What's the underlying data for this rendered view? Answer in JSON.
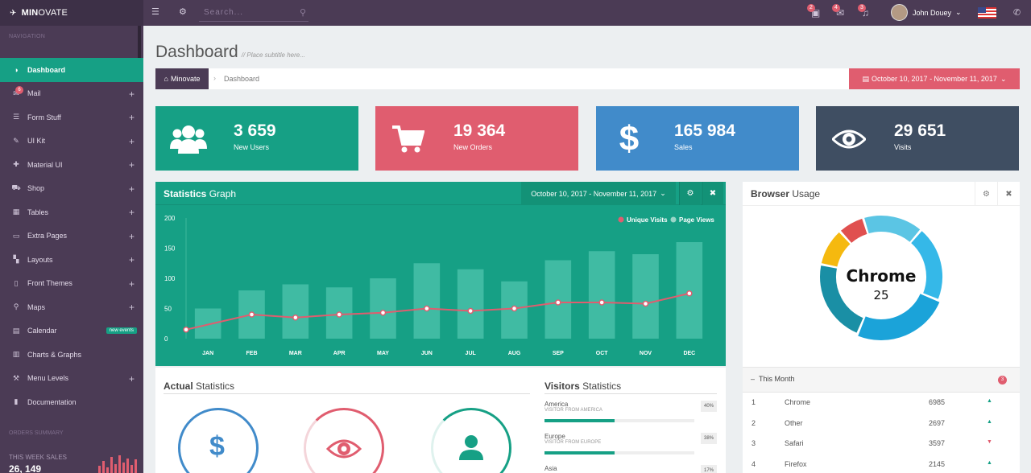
{
  "topbar": {
    "brand_bold": "MIN",
    "brand_rest": "OVATE",
    "search_placeholder": "Search...",
    "notifications": [
      "2",
      "4",
      "3"
    ],
    "user_name": "John Douey"
  },
  "sidebar": {
    "nav_title": "NAVIGATION",
    "items": [
      {
        "label": "Dashboard",
        "icon": "dashboard-icon",
        "glyph": "◑",
        "active": true
      },
      {
        "label": "Mail",
        "icon": "mail-icon",
        "glyph": "✉",
        "badge": "6",
        "plus": true
      },
      {
        "label": "Form Stuff",
        "icon": "list-icon",
        "glyph": "☰",
        "plus": true
      },
      {
        "label": "UI Kit",
        "icon": "pencil-icon",
        "glyph": "✎",
        "plus": true
      },
      {
        "label": "Material UI",
        "icon": "puzzle-icon",
        "glyph": "✚",
        "plus": true
      },
      {
        "label": "Shop",
        "icon": "cart-icon",
        "glyph": "⛟",
        "plus": true
      },
      {
        "label": "Tables",
        "icon": "table-icon",
        "glyph": "▦",
        "plus": true
      },
      {
        "label": "Extra Pages",
        "icon": "desktop-icon",
        "glyph": "▭",
        "plus": true
      },
      {
        "label": "Layouts",
        "icon": "layout-icon",
        "glyph": "▚",
        "plus": true
      },
      {
        "label": "Front Themes",
        "icon": "file-icon",
        "glyph": "▯",
        "plus": true
      },
      {
        "label": "Maps",
        "icon": "marker-icon",
        "glyph": "⚲",
        "plus": true
      },
      {
        "label": "Calendar",
        "icon": "calendar-icon",
        "glyph": "▤",
        "pill": "new events"
      },
      {
        "label": "Charts & Graphs",
        "icon": "chart-icon",
        "glyph": "▥"
      },
      {
        "label": "Menu Levels",
        "icon": "magic-icon",
        "glyph": "⚒",
        "plus": true
      },
      {
        "label": "Documentation",
        "icon": "book-icon",
        "glyph": "▮"
      }
    ],
    "orders_title": "ORDERS SUMMARY",
    "this_week_label": "THIS WEEK SALES",
    "this_week_value": "26, 149",
    "mini_bars": [
      0.4,
      0.7,
      0.3,
      0.9,
      0.5,
      1.0,
      0.6,
      0.8,
      0.45,
      0.75
    ]
  },
  "page": {
    "title": "Dashboard",
    "subtitle": "// Place subtitle here...",
    "breadcrumb_home": "Minovate",
    "breadcrumb_current": "Dashboard",
    "date_range": "October 10, 2017 - November 11, 2017"
  },
  "tiles": [
    {
      "value": "3 659",
      "label": "New Users",
      "color": "#16a085",
      "icon": "users-icon"
    },
    {
      "value": "19 364",
      "label": "New Orders",
      "color": "#e05d6f",
      "icon": "cart-icon"
    },
    {
      "value": "165 984",
      "label": "Sales",
      "color": "#418bca",
      "icon": "dollar-icon"
    },
    {
      "value": "29 651",
      "label": "Visits",
      "color": "#3f4e62",
      "icon": "eye-icon"
    }
  ],
  "statistics": {
    "title_bold": "Statistics",
    "title_rest": " Graph",
    "date_range": "October 10, 2017 - November 11, 2017"
  },
  "chart_data": {
    "type": "bar",
    "categories": [
      "JAN",
      "FEB",
      "MAR",
      "APR",
      "MAY",
      "JUN",
      "JUL",
      "AUG",
      "SEP",
      "OCT",
      "NOV",
      "DEC"
    ],
    "series": [
      {
        "name": "Page Views",
        "type": "bar",
        "values": [
          50,
          80,
          90,
          85,
          100,
          125,
          115,
          95,
          130,
          145,
          140,
          160
        ]
      },
      {
        "name": "Unique Visits",
        "type": "line",
        "values": [
          15,
          40,
          35,
          40,
          43,
          50,
          46,
          50,
          60,
          60,
          58,
          75
        ]
      }
    ],
    "yticks": [
      "0",
      "50",
      "100",
      "150",
      "200"
    ],
    "ylim": [
      0,
      200
    ],
    "legend": "top-right",
    "colors": {
      "bars": "#48c0a8",
      "line": "#e05d6f"
    }
  },
  "actual": {
    "title_bold": "Actual",
    "title_rest": " Statistics"
  },
  "visitors": {
    "title_bold": "Visitors",
    "title_rest": " Statistics",
    "rows": [
      {
        "name": "America",
        "sub": "VISITOR FROM AMERICA",
        "pct": "40%",
        "value": 0.47
      },
      {
        "name": "Europe",
        "sub": "VISITOR FROM EUROPE",
        "pct": "38%",
        "value": 0.47
      },
      {
        "name": "Asia",
        "sub": "",
        "pct": "17%",
        "value": 0.2
      }
    ]
  },
  "browser": {
    "title_bold": "Browser",
    "title_rest": " Usage",
    "center_name": "Chrome",
    "center_value": "25",
    "month_label": "This Month",
    "month_badge": "3",
    "rows": [
      {
        "rank": "1",
        "name": "Chrome",
        "value": "6985",
        "trend": "up"
      },
      {
        "rank": "2",
        "name": "Other",
        "value": "2697",
        "trend": "up"
      },
      {
        "rank": "3",
        "name": "Safari",
        "value": "3597",
        "trend": "down"
      },
      {
        "rank": "4",
        "name": "Firefox",
        "value": "2145",
        "trend": "up"
      }
    ],
    "segments": [
      {
        "value": 25,
        "color": "#1ba3d9"
      },
      {
        "value": 22,
        "color": "#1a8fa5"
      },
      {
        "value": 10,
        "color": "#f5b90f"
      },
      {
        "value": 7,
        "color": "#e0504f"
      },
      {
        "value": 16,
        "color": "#5bc5e4"
      },
      {
        "value": 20,
        "color": "#35b8e8"
      }
    ]
  }
}
